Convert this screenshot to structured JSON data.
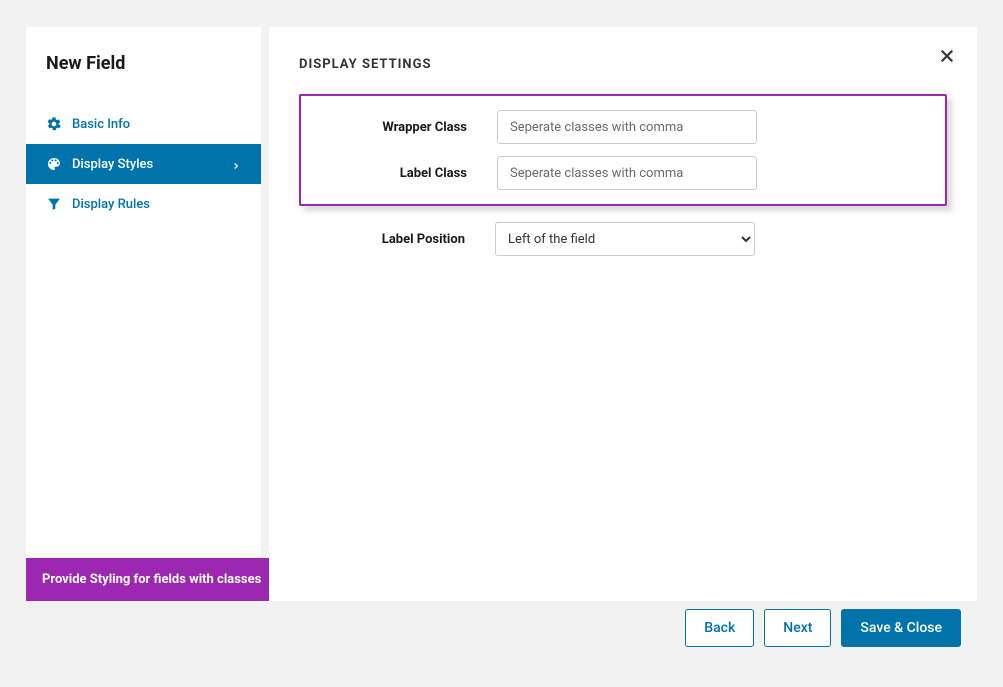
{
  "sidebar": {
    "title": "New Field",
    "items": [
      {
        "label": "Basic Info"
      },
      {
        "label": "Display Styles"
      },
      {
        "label": "Display Rules"
      }
    ]
  },
  "content": {
    "heading": "DISPLAY SETTINGS",
    "wrapper_class_label": "Wrapper Class",
    "wrapper_class_placeholder": "Seperate classes with comma",
    "label_class_label": "Label Class",
    "label_class_placeholder": "Seperate classes with comma",
    "label_position_label": "Label Position",
    "label_position_value": "Left of the field"
  },
  "banner": "Provide Styling for fields with classes",
  "footer": {
    "back": "Back",
    "next": "Next",
    "save": "Save & Close"
  }
}
